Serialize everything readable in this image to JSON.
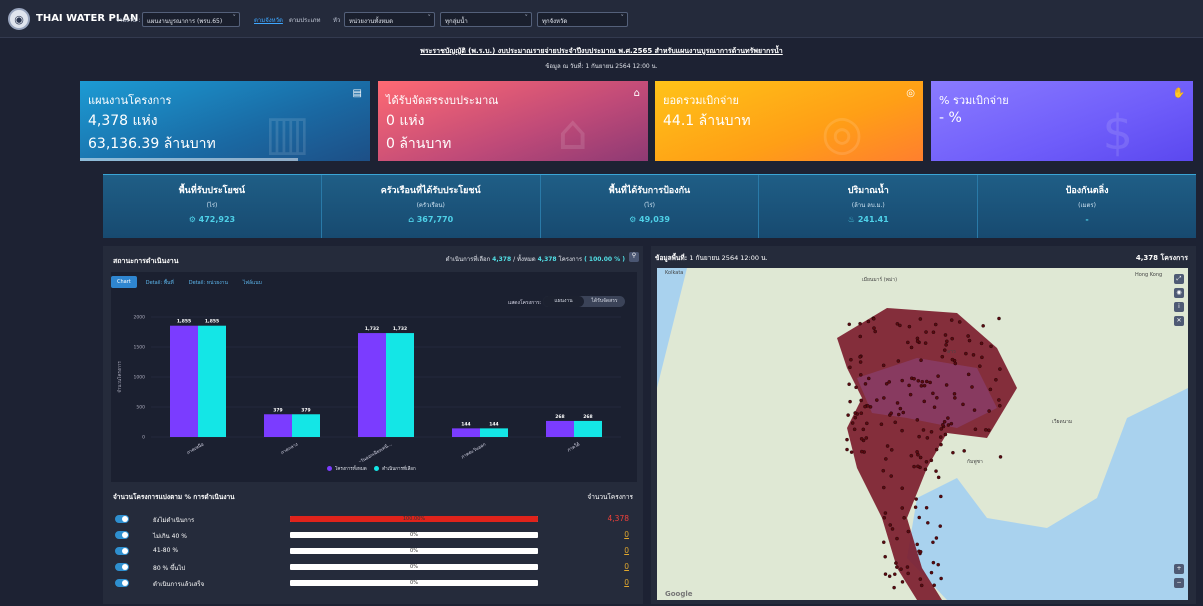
{
  "topbar": {
    "brand": "THAI WATER PLAN",
    "plan_label": "รายงาน :",
    "plan_value": "แผนงานบูรณาการ (พรบ.65)",
    "toggle_left": "ตามจังหวัด",
    "toggle_right": "ตามประเภท",
    "group_label": "หัว",
    "agency_value": "หน่วยงานทั้งหมด",
    "basin_value": "ทุกลุ่มน้ำ",
    "province_value": "ทุกจังหวัด"
  },
  "act": {
    "title": "พระราชบัญญัติ (พ.ร.บ.) งบประมาณรายจ่ายประจำปีงบประมาณ พ.ศ.2565 สำหรับแผนงานบูรณาการด้านทรัพยากรน้ำ",
    "date": "ข้อมูล ณ วันที่: 1 กันยายน 2564 12:00 น."
  },
  "cards": [
    {
      "title": "แผนงานโครงการ",
      "line1": "4,378 แห่ง",
      "line2": "63,136.39 ล้านบาท",
      "icon": "chart-icon"
    },
    {
      "title": "ได้รับจัดสรรงบประมาณ",
      "line1": "0 แห่ง",
      "line2": "0 ล้านบาท",
      "icon": "bank-icon"
    },
    {
      "title": "ยอดรวมเบิกจ่าย",
      "line1": "44.1 ล้านบาท",
      "line2": "",
      "icon": "coins-icon"
    },
    {
      "title": "% รวมเบิกจ่าย",
      "line1": "- %",
      "line2": "",
      "icon": "hand-money-icon"
    }
  ],
  "stats": [
    {
      "label": "พื้นที่รับประโยชน์",
      "unit": "(ไร่)",
      "value": "472,923",
      "icon": "⚙"
    },
    {
      "label": "ครัวเรือนที่ได้รับประโยชน์",
      "unit": "(ครัวเรือน)",
      "value": "367,770",
      "icon": "⌂"
    },
    {
      "label": "พื้นที่ได้รับการป้องกัน",
      "unit": "(ไร่)",
      "value": "49,039",
      "icon": "⚙"
    },
    {
      "label": "ปริมาณน้ำ",
      "unit": "(ล้าน ลบ.ม.)",
      "value": "241.41",
      "icon": "♨"
    },
    {
      "label": "ป้องกันตลิ่ง",
      "unit": "(เมตร)",
      "value": "-",
      "icon": ""
    }
  ],
  "left_panel": {
    "title": "สถานะการดำเนินงาน",
    "summary_prefix": "ดำเนินการที่เลือก",
    "summary_selected": "4,378",
    "summary_mid": "/ ทั้งหมด",
    "summary_total": "4,378",
    "summary_unit": "โครงการ",
    "summary_pct": "( 100.00 % )",
    "tabs": [
      "Chart",
      "Detail: พื้นที่",
      "Detail: หน่วยงาน",
      "ไฟล์แนบ"
    ],
    "series_label": "แสดงโครงการ:",
    "seg_on": "แผนงาน",
    "seg_off": "ได้รับจัดสรร",
    "progress_title": "จำนวนโครงการแบ่งตาม % การดำเนินงาน",
    "progress_count_title": "จำนวนโครงการ",
    "progress": [
      {
        "label": "ยังไม่ดำเนินการ",
        "pct": 100,
        "pct_text": "100.00%",
        "count": "4,378"
      },
      {
        "label": "ไม่เกิน 40 %",
        "pct": 0,
        "pct_text": "0%",
        "count": "0"
      },
      {
        "label": "41-80 %",
        "pct": 0,
        "pct_text": "0%",
        "count": "0"
      },
      {
        "label": "80 % ขึ้นไป",
        "pct": 0,
        "pct_text": "0%",
        "count": "0"
      },
      {
        "label": "ดำเนินการแล้วเสร็จ",
        "pct": 0,
        "pct_text": "0%",
        "count": "0"
      }
    ]
  },
  "chart_data": {
    "type": "bar",
    "categories": [
      "ภาคเหนือ",
      "ภาคกลาง",
      "ภาคตะวันออกเฉียงเหนื...",
      "ภาคตะวันออก",
      "ภาคใต้"
    ],
    "series": [
      {
        "name": "โครงการทั้งหมด",
        "values": [
          1855,
          379,
          1732,
          144,
          268
        ],
        "color": "#7b3cff"
      },
      {
        "name": "ดำเนินการที่เลือก",
        "values": [
          1855,
          379,
          1732,
          144,
          268
        ],
        "color": "#14e6e6"
      }
    ],
    "ylabel": "จำนวนโครงการ",
    "yticks": [
      0,
      500,
      1000,
      1500,
      2000
    ],
    "ylim": [
      0,
      2000
    ],
    "data_labels": [
      "1,855",
      "1,855",
      "379",
      "379",
      "1,732",
      "1,732",
      "144",
      "144",
      "268",
      "268"
    ]
  },
  "right_panel": {
    "title_prefix": "ข้อมูลพื้นที่:",
    "title_date": "1 กันยายน 2564 12:00 น.",
    "count": "4,378 โครงการ",
    "map_labels": [
      "Kolkata",
      "เมียนมาร์ (พม่า)",
      "ลาว",
      "เวียดนาม",
      "กัมพูชา",
      "Hong Kong"
    ],
    "google": "Google"
  }
}
